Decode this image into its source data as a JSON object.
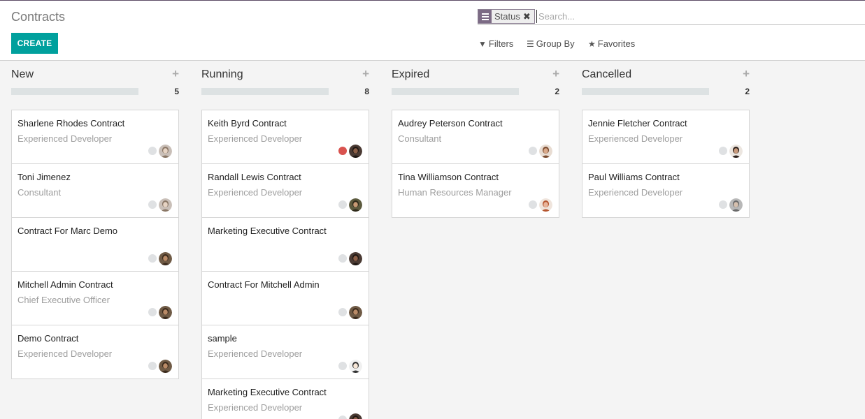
{
  "header": {
    "title": "Contracts",
    "create_label": "CREATE"
  },
  "search": {
    "facet_label": "Status",
    "placeholder": "Search...",
    "filters_label": "Filters",
    "group_by_label": "Group By",
    "favorites_label": "Favorites"
  },
  "columns": [
    {
      "title": "New",
      "count": "5",
      "cards": [
        {
          "title": "Sharlene Rhodes Contract",
          "subtitle": "Experienced Developer",
          "status": "grey",
          "avatar": "woman-light"
        },
        {
          "title": "Toni Jimenez",
          "subtitle": "Consultant",
          "status": "grey",
          "avatar": "woman-light"
        },
        {
          "title": "Contract For Marc Demo",
          "subtitle": "",
          "status": "grey",
          "avatar": "man-brown"
        },
        {
          "title": "Mitchell Admin Contract",
          "subtitle": "Chief Executive Officer",
          "status": "grey",
          "avatar": "man-brown"
        },
        {
          "title": "Demo Contract",
          "subtitle": "Experienced Developer",
          "status": "grey",
          "avatar": "man-brown"
        }
      ]
    },
    {
      "title": "Running",
      "count": "8",
      "cards": [
        {
          "title": "Keith Byrd Contract",
          "subtitle": "Experienced Developer",
          "status": "red",
          "avatar": "man-dark"
        },
        {
          "title": "Randall Lewis Contract",
          "subtitle": "Experienced Developer",
          "status": "grey",
          "avatar": "man-olive"
        },
        {
          "title": "Marketing Executive Contract",
          "subtitle": "",
          "status": "grey",
          "avatar": "man-dark"
        },
        {
          "title": "Contract For Mitchell Admin",
          "subtitle": "",
          "status": "grey",
          "avatar": "man-brown"
        },
        {
          "title": "sample",
          "subtitle": "Experienced Developer",
          "status": "grey",
          "avatar": "placeholder"
        },
        {
          "title": "Marketing Executive Contract",
          "subtitle": "Experienced Developer",
          "status": "grey",
          "avatar": "man-dark"
        }
      ]
    },
    {
      "title": "Expired",
      "count": "2",
      "cards": [
        {
          "title": "Audrey Peterson Contract",
          "subtitle": "Consultant",
          "status": "grey",
          "avatar": "woman-brown"
        },
        {
          "title": "Tina Williamson Contract",
          "subtitle": "Human Resources Manager",
          "status": "grey",
          "avatar": "woman-red"
        }
      ]
    },
    {
      "title": "Cancelled",
      "count": "2",
      "cards": [
        {
          "title": "Jennie Fletcher Contract",
          "subtitle": "Experienced Developer",
          "status": "grey",
          "avatar": "woman-dark"
        },
        {
          "title": "Paul Williams Contract",
          "subtitle": "Experienced Developer",
          "status": "grey",
          "avatar": "man-grey"
        }
      ]
    }
  ],
  "colors": {
    "accent": "#00a09d",
    "facet": "#7c6b85",
    "status_red": "#d9534f",
    "status_grey": "#dfe1e3"
  }
}
